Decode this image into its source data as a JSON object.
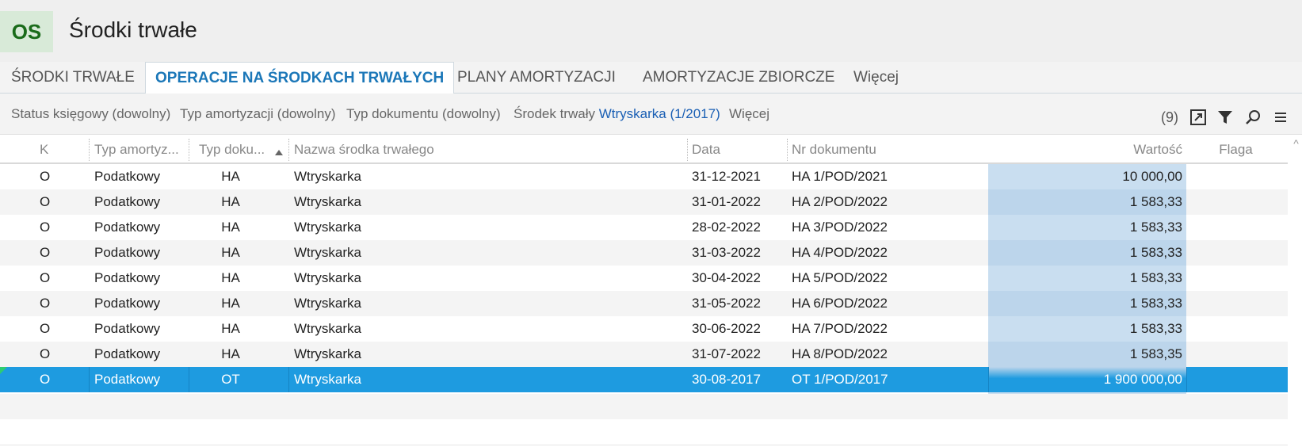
{
  "header": {
    "badge": "OS",
    "title": "Środki trwałe"
  },
  "tabs": [
    {
      "label": "ŚRODKI TRWAŁE"
    },
    {
      "label": "OPERACJE NA ŚRODKACH TRWAŁYCH"
    },
    {
      "label": "PLANY AMORTYZACJI"
    },
    {
      "label": "AMORTYZACJE ZBIORCZE"
    },
    {
      "label": "Więcej"
    }
  ],
  "filters": {
    "status": "Status księgowy (dowolny)",
    "amort_type": "Typ amortyzacji (dowolny)",
    "doc_type": "Typ dokumentu (dowolny)",
    "asset_label": "Środek trwały",
    "asset_value": "Wtryskarka (1/2017)",
    "more": "Więcej"
  },
  "toolbar": {
    "count": "(9)"
  },
  "columns": {
    "k": "K",
    "amort": "Typ amortyz...",
    "doc": "Typ doku...",
    "name": "Nazwa środka trwałego",
    "date": "Data",
    "number": "Nr dokumentu",
    "value": "Wartość",
    "flag": "Flaga"
  },
  "rows": [
    {
      "k": "O",
      "amort": "Podatkowy",
      "doc": "HA",
      "name": "Wtryskarka",
      "date": "31-12-2021",
      "number": "HA 1/POD/2021",
      "value": "10 000,00"
    },
    {
      "k": "O",
      "amort": "Podatkowy",
      "doc": "HA",
      "name": "Wtryskarka",
      "date": "31-01-2022",
      "number": "HA 2/POD/2022",
      "value": "1 583,33"
    },
    {
      "k": "O",
      "amort": "Podatkowy",
      "doc": "HA",
      "name": "Wtryskarka",
      "date": "28-02-2022",
      "number": "HA 3/POD/2022",
      "value": "1 583,33"
    },
    {
      "k": "O",
      "amort": "Podatkowy",
      "doc": "HA",
      "name": "Wtryskarka",
      "date": "31-03-2022",
      "number": "HA 4/POD/2022",
      "value": "1 583,33"
    },
    {
      "k": "O",
      "amort": "Podatkowy",
      "doc": "HA",
      "name": "Wtryskarka",
      "date": "30-04-2022",
      "number": "HA 5/POD/2022",
      "value": "1 583,33"
    },
    {
      "k": "O",
      "amort": "Podatkowy",
      "doc": "HA",
      "name": "Wtryskarka",
      "date": "31-05-2022",
      "number": "HA 6/POD/2022",
      "value": "1 583,33"
    },
    {
      "k": "O",
      "amort": "Podatkowy",
      "doc": "HA",
      "name": "Wtryskarka",
      "date": "30-06-2022",
      "number": "HA 7/POD/2022",
      "value": "1 583,33"
    },
    {
      "k": "O",
      "amort": "Podatkowy",
      "doc": "HA",
      "name": "Wtryskarka",
      "date": "31-07-2022",
      "number": "HA 8/POD/2022",
      "value": "1 583,35"
    },
    {
      "k": "O",
      "amort": "Podatkowy",
      "doc": "OT",
      "name": "Wtryskarka",
      "date": "30-08-2017",
      "number": "OT 1/POD/2017",
      "value": "1 900 000,00"
    }
  ],
  "colors": {
    "accent": "#1b77b8",
    "selected_row": "#1e9be0",
    "value_column": "#c9def0",
    "badge_text": "#1a6b1a"
  },
  "icons": [
    "export-icon",
    "filter-icon",
    "search-icon",
    "menu-icon",
    "sort-ascending-icon",
    "scroll-up-icon"
  ]
}
